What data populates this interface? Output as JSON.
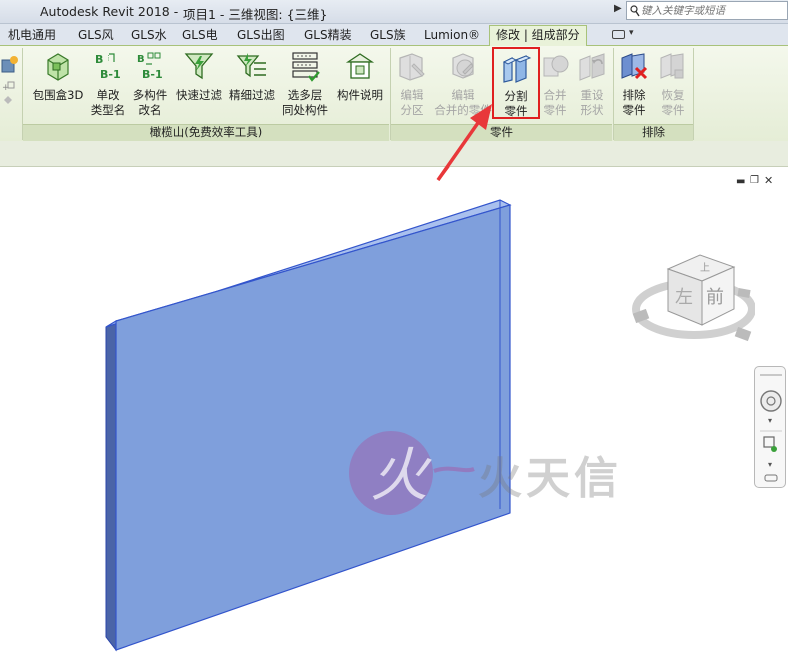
{
  "titlebar": {
    "app_title": "Autodesk Revit 2018 -",
    "project_title": "项目1 - 三维视图: {三维}",
    "search_placeholder": "键入关键字或短语"
  },
  "tabs": [
    {
      "label": "机电通用"
    },
    {
      "label": "GLS风"
    },
    {
      "label": "GLS水"
    },
    {
      "label": "GLS电"
    },
    {
      "label": "GLS出图"
    },
    {
      "label": "GLS精装"
    },
    {
      "label": "GLS族"
    },
    {
      "label": "Lumion®"
    },
    {
      "label": "修改 | 组成部分",
      "active": true
    }
  ],
  "ribbon": {
    "panel_gls": {
      "label": "橄榄山(免费效率工具)",
      "buttons": [
        {
          "label": "包围盒3D",
          "icon": "bounding-box-3d-icon"
        },
        {
          "label": "单改\n类型名",
          "icon": "rename-type-icon"
        },
        {
          "label": "多构件\n改名",
          "icon": "multi-rename-icon"
        },
        {
          "label": "快速过滤",
          "icon": "quick-filter-icon"
        },
        {
          "label": "精细过滤",
          "icon": "fine-filter-icon"
        },
        {
          "label": "选多层\n同处构件",
          "icon": "multi-level-select-icon"
        },
        {
          "label": "构件说明",
          "icon": "component-info-icon"
        }
      ]
    },
    "panel_parts": {
      "label": "零件",
      "buttons": [
        {
          "label": "编辑\n分区",
          "icon": "edit-division-icon",
          "disabled": true
        },
        {
          "label": "编辑\n合并的零件",
          "icon": "edit-merged-parts-icon",
          "disabled": true
        },
        {
          "label": "分割\n零件",
          "icon": "divide-parts-icon",
          "disabled": false
        },
        {
          "label": "合并\n零件",
          "icon": "merge-parts-icon",
          "disabled": true
        },
        {
          "label": "重设\n形状",
          "icon": "reset-shape-icon",
          "disabled": true
        }
      ]
    },
    "panel_exclude": {
      "label": "排除",
      "buttons": [
        {
          "label": "排除\n零件",
          "icon": "exclude-parts-icon",
          "disabled": false
        },
        {
          "label": "恢复\n零件",
          "icon": "restore-parts-icon",
          "disabled": true
        }
      ]
    }
  },
  "viewcube": {
    "left_face": "左",
    "front_face": "前",
    "top_face": "上"
  },
  "watermark": {
    "text": "火天信"
  },
  "colors": {
    "wall_face": "#7f9fdc",
    "wall_edge": "#3355cc",
    "highlight": "#e02020",
    "ribbon_bg": "#eef3e3"
  }
}
